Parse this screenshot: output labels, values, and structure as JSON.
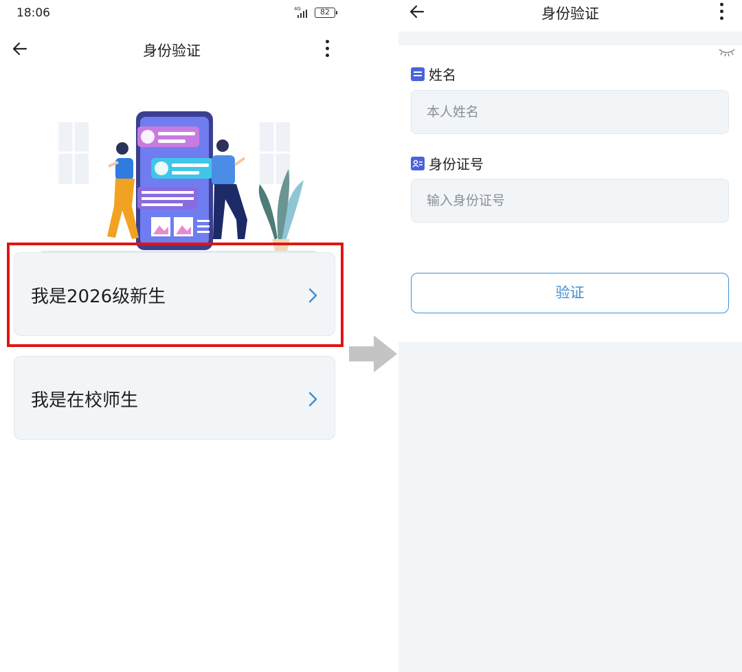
{
  "left": {
    "status": {
      "time": "18:06",
      "network": "4G",
      "battery": "82"
    },
    "nav": {
      "title": "身份验证"
    },
    "options": [
      {
        "label": "我是2026级新生",
        "highlighted": true
      },
      {
        "label": "我是在校师生",
        "highlighted": false
      }
    ]
  },
  "right": {
    "nav": {
      "title": "身份验证"
    },
    "fields": [
      {
        "label": "姓名",
        "placeholder": "本人姓名",
        "value": ""
      },
      {
        "label": "身份证号",
        "placeholder": "输入身份证号",
        "value": ""
      }
    ],
    "verify_label": "验证"
  },
  "colors": {
    "accent": "#3f8fd0",
    "highlight": "#e01414",
    "label_icon": "#4a63d9",
    "card_bg": "#f2f5f8"
  },
  "icons": [
    "back-arrow-icon",
    "more-vertical-icon",
    "chevron-right-icon",
    "eye-closed-icon",
    "name-card-icon",
    "id-card-icon",
    "right-arrow-icon"
  ]
}
